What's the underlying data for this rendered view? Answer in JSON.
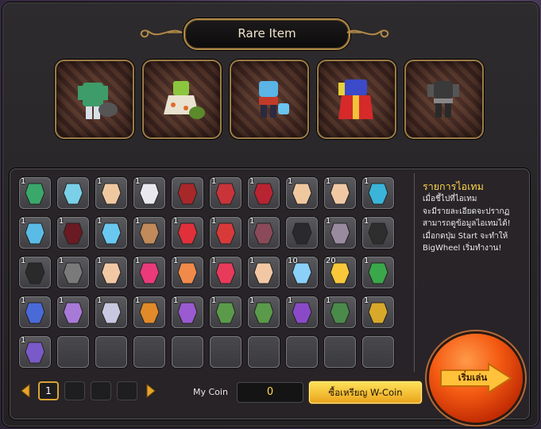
{
  "title": "Rare Item",
  "rare_items": [
    {
      "icon": "green-coat-outfit-icon"
    },
    {
      "icon": "floral-dress-outfit-icon"
    },
    {
      "icon": "blue-armor-outfit-icon"
    },
    {
      "icon": "colorful-robe-outfit-icon"
    },
    {
      "icon": "black-suit-outfit-icon"
    }
  ],
  "inventory": [
    [
      {
        "icon": "green-shirt-icon",
        "qty": "1"
      },
      {
        "icon": "blue-pants-icon",
        "qty": ""
      },
      {
        "icon": "hand-icon",
        "qty": "1"
      },
      {
        "icon": "white-boot-icon",
        "qty": "1"
      },
      {
        "icon": "red-hair-icon",
        "qty": ""
      },
      {
        "icon": "red-dress-icon",
        "qty": "1"
      },
      {
        "icon": "red-skirt-icon",
        "qty": "1"
      },
      {
        "icon": "hand-icon",
        "qty": "1"
      },
      {
        "icon": "leg-icon",
        "qty": "1"
      },
      {
        "icon": "blue-cap-icon",
        "qty": "1"
      }
    ],
    [
      {
        "icon": "blue-shirt-icon",
        "qty": "1"
      },
      {
        "icon": "maroon-pants-icon",
        "qty": "1"
      },
      {
        "icon": "blue-glove-icon",
        "qty": "1"
      },
      {
        "icon": "brown-boot-icon",
        "qty": "1"
      },
      {
        "icon": "red-bow-icon",
        "qty": "1"
      },
      {
        "icon": "red-jacket-icon",
        "qty": "1"
      },
      {
        "icon": "striped-skirt-icon",
        "qty": "1"
      },
      {
        "icon": "black-glove-icon",
        "qty": ""
      },
      {
        "icon": "gray-boot-icon",
        "qty": "1"
      },
      {
        "icon": "black-top-icon",
        "qty": "1"
      }
    ],
    [
      {
        "icon": "black-pants-icon",
        "qty": "1"
      },
      {
        "icon": "gray-glove-icon",
        "qty": "1"
      },
      {
        "icon": "leg-icon",
        "qty": "1"
      },
      {
        "icon": "pink-flower-icon",
        "qty": "1"
      },
      {
        "icon": "floral-dress-icon",
        "qty": "1"
      },
      {
        "icon": "red-underwear-icon",
        "qty": "1"
      },
      {
        "icon": "leg-icon",
        "qty": "1"
      },
      {
        "icon": "blue-crystal-icon",
        "qty": "10"
      },
      {
        "icon": "gold-crystal-icon",
        "qty": "20"
      },
      {
        "icon": "green-scroll-icon",
        "qty": "1"
      }
    ],
    [
      {
        "icon": "blue-scroll-icon",
        "qty": "1"
      },
      {
        "icon": "purple-sword-icon",
        "qty": "1"
      },
      {
        "icon": "silver-sword-icon",
        "qty": "1"
      },
      {
        "icon": "orange-staff-icon",
        "qty": "1"
      },
      {
        "icon": "purple-staff-icon",
        "qty": "1"
      },
      {
        "icon": "green-bow-icon",
        "qty": "1"
      },
      {
        "icon": "green-bow-icon",
        "qty": "1"
      },
      {
        "icon": "purple-claw-icon",
        "qty": "1"
      },
      {
        "icon": "green-claw-icon",
        "qty": "1"
      },
      {
        "icon": "gold-staff-icon",
        "qty": "1"
      }
    ],
    [
      {
        "icon": "gift-bag-icon",
        "qty": "1"
      },
      {
        "icon": "",
        "qty": ""
      },
      {
        "icon": "",
        "qty": ""
      },
      {
        "icon": "",
        "qty": ""
      },
      {
        "icon": "",
        "qty": ""
      },
      {
        "icon": "",
        "qty": ""
      },
      {
        "icon": "",
        "qty": ""
      },
      {
        "icon": "",
        "qty": ""
      },
      {
        "icon": "",
        "qty": ""
      },
      {
        "icon": "",
        "qty": ""
      }
    ]
  ],
  "info": {
    "title": "รายการไอเทม",
    "lines": [
      "เมื่อชี้ไปที่ไอเทม",
      "จะมีรายละเอียดจะปรากฏ",
      "สามารถดูข้อมูลไอเทมได้!",
      "เมื่อกดปุ่ม Start จะทำให้",
      "BigWheel เริ่มทำงาน!"
    ]
  },
  "pager": {
    "pages": [
      "1",
      "",
      "",
      ""
    ],
    "current": "1"
  },
  "coin": {
    "label": "My Coin",
    "value": "0",
    "button_label": "ซื้อเหรียญ W-Coin"
  },
  "start": {
    "label": "เริ่มเล่น"
  },
  "colors": {
    "accent_gold": "#d9a533",
    "coin_value": "#ffd84f",
    "start_orange": "#f45a12",
    "info_title": "#ffd54a"
  }
}
